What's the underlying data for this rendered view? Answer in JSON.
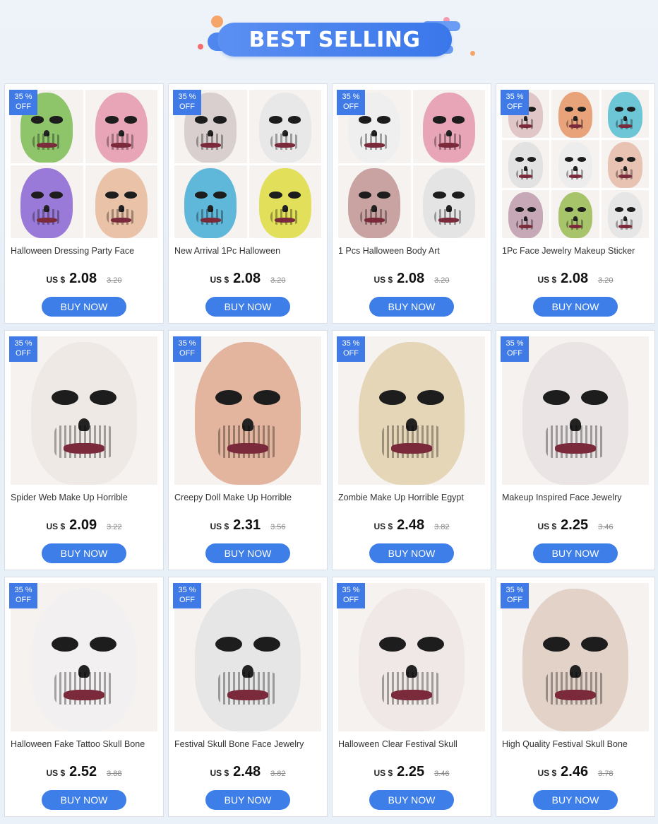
{
  "banner": {
    "title": "BEST SELLING"
  },
  "colors": {
    "accent": "#3d7ee8",
    "badge": "#3f7ae6",
    "banner": "#4a83ee"
  },
  "products": [
    {
      "badge_pct": "35 %",
      "badge_off": "OFF",
      "title": "Halloween Dressing Party Face",
      "currency": "US $",
      "price": "2.08",
      "old_price": "3.20",
      "buy": "BUY NOW",
      "layout": "quad",
      "palettes": [
        "#8ec46a",
        "#e8a5b8",
        "#9a7ad8",
        "#e9c2a8"
      ]
    },
    {
      "badge_pct": "35 %",
      "badge_off": "OFF",
      "title": "New Arrival 1Pc Halloween",
      "currency": "US $",
      "price": "2.08",
      "old_price": "3.20",
      "buy": "BUY NOW",
      "layout": "quad",
      "palettes": [
        "#d9cfcf",
        "#e8e8e8",
        "#5fb7d9",
        "#e2e05a"
      ]
    },
    {
      "badge_pct": "35 %",
      "badge_off": "OFF",
      "title": "1 Pcs Halloween Body Art",
      "currency": "US $",
      "price": "2.08",
      "old_price": "3.20",
      "buy": "BUY NOW",
      "layout": "quad",
      "palettes": [
        "#efefef",
        "#e8a5b8",
        "#c9a2a2",
        "#e4e4e4"
      ]
    },
    {
      "badge_pct": "35 %",
      "badge_off": "OFF",
      "title": "1Pc Face Jewelry Makeup Sticker",
      "currency": "US $",
      "price": "2.08",
      "old_price": "3.20",
      "buy": "BUY NOW",
      "layout": "nine",
      "palettes": [
        "#e0c6c6",
        "#e8a37a",
        "#6cc6d6",
        "#e2e2e2",
        "#ededed",
        "#e8c2b2",
        "#c6a8b6",
        "#a8c46a",
        "#e6e6e6"
      ]
    },
    {
      "badge_pct": "35 %",
      "badge_off": "OFF",
      "title": "Spider Web Make Up Horrible",
      "currency": "US $",
      "price": "2.09",
      "old_price": "3.22",
      "buy": "BUY NOW",
      "layout": "single",
      "palettes": [
        "#efe9e6"
      ]
    },
    {
      "badge_pct": "35 %",
      "badge_off": "OFF",
      "title": "Creepy Doll Make Up Horrible",
      "currency": "US $",
      "price": "2.31",
      "old_price": "3.56",
      "buy": "BUY NOW",
      "layout": "single",
      "palettes": [
        "#e3b49e"
      ]
    },
    {
      "badge_pct": "35 %",
      "badge_off": "OFF",
      "title": "Zombie Make Up Horrible Egypt",
      "currency": "US $",
      "price": "2.48",
      "old_price": "3.82",
      "buy": "BUY NOW",
      "layout": "single",
      "palettes": [
        "#e6d6b8"
      ]
    },
    {
      "badge_pct": "35 %",
      "badge_off": "OFF",
      "title": "Makeup Inspired Face Jewelry",
      "currency": "US $",
      "price": "2.25",
      "old_price": "3.46",
      "buy": "BUY NOW",
      "layout": "single",
      "palettes": [
        "#ebe4e4"
      ]
    },
    {
      "badge_pct": "35 %",
      "badge_off": "OFF",
      "title": "Halloween Fake Tattoo Skull Bone",
      "currency": "US $",
      "price": "2.52",
      "old_price": "3.88",
      "buy": "BUY NOW",
      "layout": "single",
      "palettes": [
        "#f2f0f0"
      ]
    },
    {
      "badge_pct": "35 %",
      "badge_off": "OFF",
      "title": "Festival Skull Bone Face Jewelry",
      "currency": "US $",
      "price": "2.48",
      "old_price": "3.82",
      "buy": "BUY NOW",
      "layout": "single",
      "palettes": [
        "#e6e6e6"
      ]
    },
    {
      "badge_pct": "35 %",
      "badge_off": "OFF",
      "title": "Halloween Clear Festival Skull",
      "currency": "US $",
      "price": "2.25",
      "old_price": "3.46",
      "buy": "BUY NOW",
      "layout": "single",
      "palettes": [
        "#efe8e6"
      ]
    },
    {
      "badge_pct": "35 %",
      "badge_off": "OFF",
      "title": "High Quality Festival Skull Bone",
      "currency": "US $",
      "price": "2.46",
      "old_price": "3.78",
      "buy": "BUY NOW",
      "layout": "single",
      "palettes": [
        "#e3d2c8"
      ]
    }
  ]
}
